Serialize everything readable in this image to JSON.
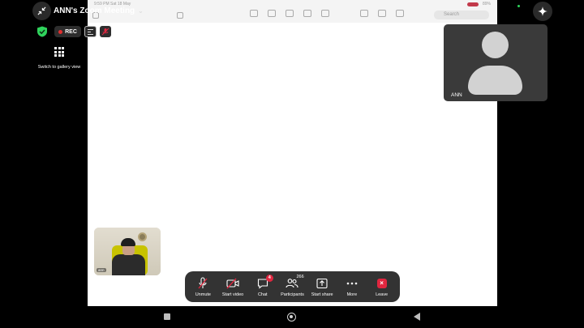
{
  "meeting": {
    "title": "ANN's Zoom Meeting",
    "rec_label": "REC"
  },
  "left_panel": {
    "gallery_label": "Switch to gallery view"
  },
  "participant_tile": {
    "name": "ANN"
  },
  "self_view": {
    "name": "ann"
  },
  "shared_screen": {
    "status_time": "9:59 PM  Sat 18 May",
    "battery": "89%",
    "search_placeholder": "Search"
  },
  "toolbar": {
    "unmute_label": "Unmute",
    "start_video_label": "Start video",
    "chat_label": "Chat",
    "chat_badge": "4",
    "participants_label": "Participants",
    "participants_count": "266",
    "start_share_label": "Start share",
    "more_label": "More",
    "leave_label": "Leave"
  },
  "colors": {
    "accent_red": "#e0263f",
    "secure_green": "#2fd35c",
    "toolbar_bg": "#333333"
  },
  "icons": {
    "exit_fullscreen": "exit-fullscreen-icon",
    "security": "shield-check-icon",
    "captions": "captions-icon",
    "muted_mic": "mic-off-icon",
    "gallery": "grid-icon",
    "ai_companion": "sparkle-icon"
  }
}
